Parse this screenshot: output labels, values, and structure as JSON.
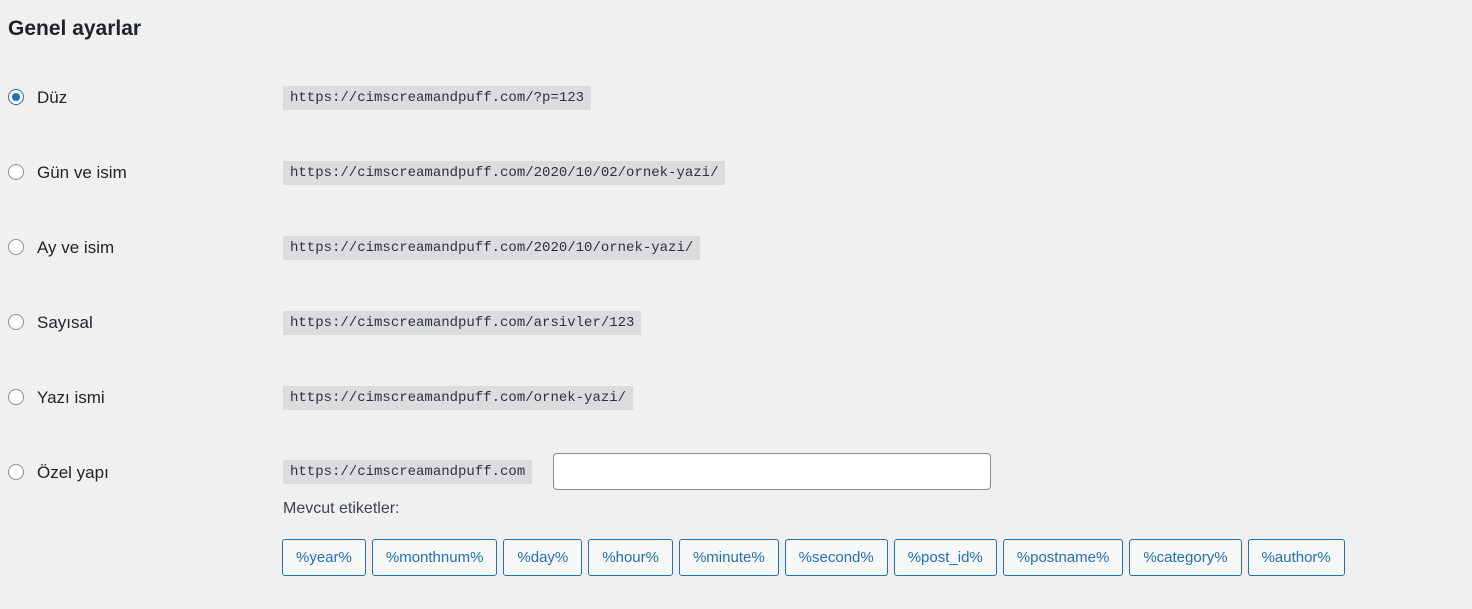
{
  "section_title": "Genel ayarlar",
  "options": [
    {
      "label": "Düz",
      "example": "https://cimscreamandpuff.com/?p=123",
      "selected": true
    },
    {
      "label": "Gün ve isim",
      "example": "https://cimscreamandpuff.com/2020/10/02/ornek-yazi/",
      "selected": false
    },
    {
      "label": "Ay ve isim",
      "example": "https://cimscreamandpuff.com/2020/10/ornek-yazi/",
      "selected": false
    },
    {
      "label": "Sayısal",
      "example": "https://cimscreamandpuff.com/arsivler/123",
      "selected": false
    },
    {
      "label": "Yazı ismi",
      "example": "https://cimscreamandpuff.com/ornek-yazi/",
      "selected": false
    },
    {
      "label": "Özel yapı",
      "example": "https://cimscreamandpuff.com",
      "selected": false
    }
  ],
  "custom_structure": {
    "value": "",
    "available_tags_label": "Mevcut etiketler:",
    "tags": [
      "%year%",
      "%monthnum%",
      "%day%",
      "%hour%",
      "%minute%",
      "%second%",
      "%post_id%",
      "%postname%",
      "%category%",
      "%author%"
    ]
  },
  "colors": {
    "accent": "#2271b1",
    "background": "#f0f0f1",
    "code_background": "#dcdcde"
  }
}
